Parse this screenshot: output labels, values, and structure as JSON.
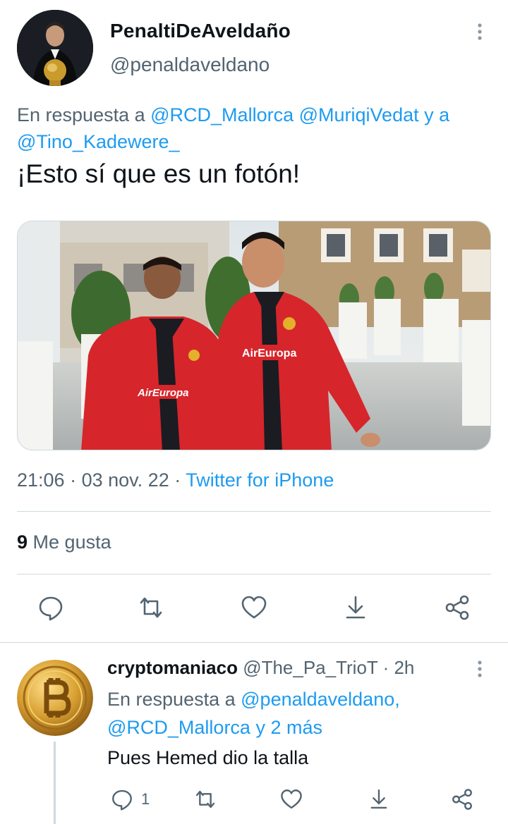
{
  "tweet": {
    "display_name": "PenaltiDeAveldaño",
    "handle": "@penaldaveldano",
    "reply_prefix": "En respuesta a",
    "mention1": "@RCD_Mallorca",
    "mention2": "@MuriqiVedat",
    "reply_and": "y a",
    "mention3": "@Tino_Kadewere_",
    "text": "¡Esto sí que es un fotón!",
    "media_sign1": "AirEuropa",
    "media_sign2": "AirEuropa",
    "time": "21:06",
    "date": "03 nov. 22",
    "separator": "·",
    "source": "Twitter for iPhone",
    "likes_count": "9",
    "likes_label": "Me gusta"
  },
  "reply": {
    "display_name": "cryptomaniaco",
    "handle": "@The_Pa_TrioT",
    "separator": "·",
    "time": "2h",
    "reply_prefix": "En respuesta a",
    "mention1": "@penaldaveldano,",
    "mention2": "@RCD_Mallorca",
    "reply_more": "y 2 más",
    "text": "Pues Hemed dio la talla",
    "reply_count": "1"
  },
  "icons": {
    "reply": "comment-icon",
    "retweet": "retweet-icon",
    "like": "heart-icon",
    "share_down": "share-down-icon",
    "share": "share-nodes-icon",
    "more": "more-vertical-icon"
  },
  "colors": {
    "accent": "#1d9bf0",
    "secondary_text": "#536471",
    "divider": "#cfd9de",
    "kit_red": "#d6262b"
  }
}
